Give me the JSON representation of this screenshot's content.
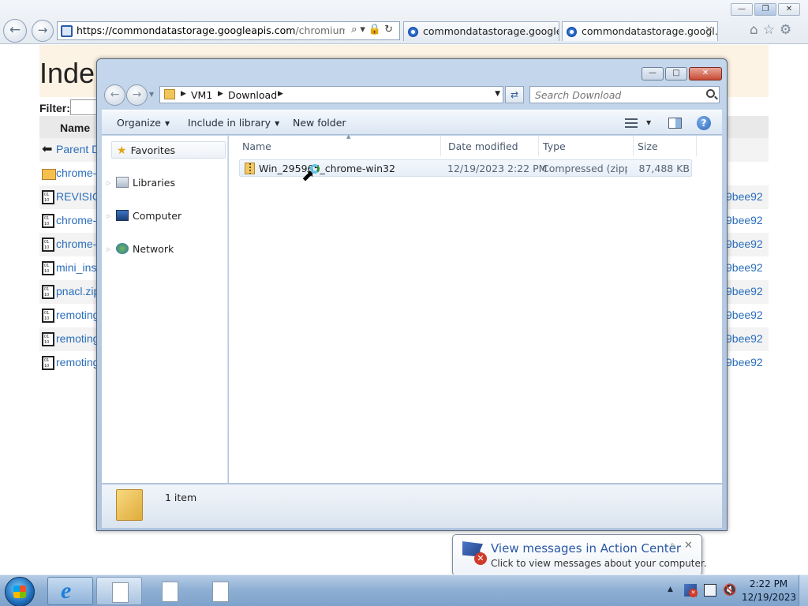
{
  "browser": {
    "url_domain": "https://commondatastorage.googleapis.com",
    "url_rest": "/chromium-browse",
    "tabs": [
      {
        "label": "commondatastorage.googlea..."
      },
      {
        "label": "commondatastorage.googl..."
      }
    ]
  },
  "web_page": {
    "title": "Inde",
    "filter_label": "Filter:",
    "name_header": "Name",
    "rows": [
      {
        "name": "Parent D",
        "hash": ""
      },
      {
        "name": "chrome-",
        "hash": ""
      },
      {
        "name": "REVISIC",
        "hash": "9bee92"
      },
      {
        "name": "chrome-",
        "hash": "9bee92"
      },
      {
        "name": "chrome-",
        "hash": "9bee92"
      },
      {
        "name": "mini_ins",
        "hash": "9bee92"
      },
      {
        "name": "pnacl.zip",
        "hash": "9bee92"
      },
      {
        "name": "remoting",
        "hash": "9bee92"
      },
      {
        "name": "remoting",
        "hash": "9bee92"
      },
      {
        "name": "remoting",
        "hash": "9bee92"
      }
    ]
  },
  "explorer": {
    "breadcrumb": [
      "VM1",
      "Download"
    ],
    "search_placeholder": "Search Download",
    "toolbar": {
      "organize": "Organize",
      "include_in_library": "Include in library",
      "new_folder": "New folder"
    },
    "nav": {
      "favorites": "Favorites",
      "libraries": "Libraries",
      "computer": "Computer",
      "network": "Network"
    },
    "columns": {
      "name": "Name",
      "date_modified": "Date modified",
      "type": "Type",
      "size": "Size"
    },
    "files": [
      {
        "name": "Win_295965_chrome-win32",
        "date_modified": "12/19/2023 2:22 PM",
        "type": "Compressed (zipp...",
        "size": "87,488 KB"
      }
    ],
    "status_count": "1 item"
  },
  "notification": {
    "title": "View messages in Action Center",
    "text": "Click to view messages about your computer."
  },
  "taskbar": {
    "time": "2:22 PM",
    "date": "12/19/2023"
  },
  "colors": {
    "link": "#2a6ebb",
    "taskbar": "#8fb0d4",
    "window_frame": "#b7cbe4",
    "notification_title": "#2a58a5"
  }
}
